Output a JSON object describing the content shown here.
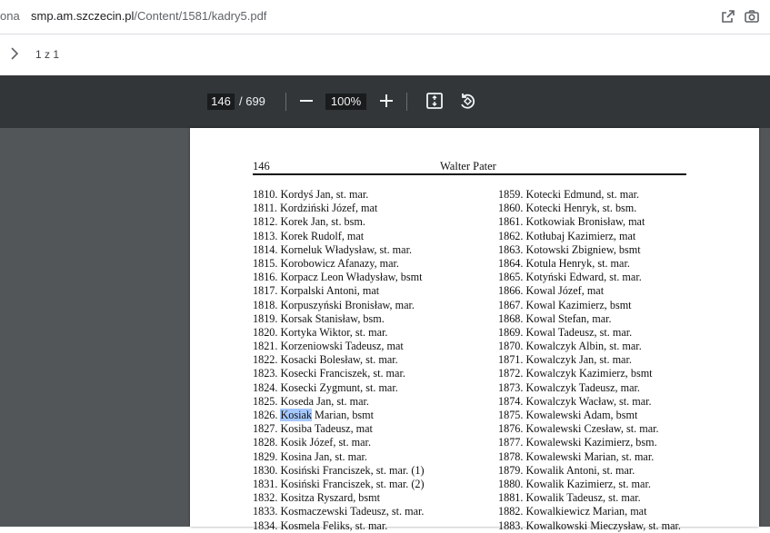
{
  "browser": {
    "left_fragment": "ona",
    "url_host": "smp.am.szczecin.pl",
    "url_path": "/Content/1581/kadry5.pdf",
    "icons": [
      "share-icon",
      "camera-icon"
    ]
  },
  "subbar": {
    "page_count": "1 z 1",
    "icon": "chevron-right-icon"
  },
  "pdf_toolbar": {
    "current_page": "146",
    "total_pages": "/ 699",
    "zoom": "100%",
    "icons": [
      "minus-icon",
      "plus-icon",
      "fit-page-icon",
      "rotate-icon"
    ]
  },
  "pdf_page": {
    "page_number": "146",
    "running_title": "Walter Pater",
    "left_column": [
      {
        "num": "1810.",
        "text": "Kordyś Jan, st. mar."
      },
      {
        "num": "1811.",
        "text": "Kordziński Józef, mat"
      },
      {
        "num": "1812.",
        "text": "Korek Jan, st. bsm."
      },
      {
        "num": "1813.",
        "text": "Korek Rudolf, mat"
      },
      {
        "num": "1814.",
        "text": "Korneluk Władysław, st. mar."
      },
      {
        "num": "1815.",
        "text": "Korobowicz Afanazy, mar."
      },
      {
        "num": "1816.",
        "text": "Korpacz Leon Władysław, bsmt"
      },
      {
        "num": "1817.",
        "text": "Korpalski Antoni, mat"
      },
      {
        "num": "1818.",
        "text": "Korpuszyński Bronisław, mar."
      },
      {
        "num": "1819.",
        "text": "Korsak Stanisław, bsm."
      },
      {
        "num": "1820.",
        "text": "Kortyka Wiktor, st. mar."
      },
      {
        "num": "1821.",
        "text": "Korzeniowski Tadeusz, mat"
      },
      {
        "num": "1822.",
        "text": "Kosacki Bolesław, st. mar."
      },
      {
        "num": "1823.",
        "text": "Kosecki Franciszek, st. mar."
      },
      {
        "num": "1824.",
        "text": "Kosecki Zygmunt, st. mar."
      },
      {
        "num": "1825.",
        "text": "Koseda Jan, st. mar."
      },
      {
        "num": "1826.",
        "text": "Marian, bsmt",
        "highlight": "Kosiak"
      },
      {
        "num": "1827.",
        "text": "Kosiba Tadeusz, mat"
      },
      {
        "num": "1828.",
        "text": "Kosik Józef, st. mar."
      },
      {
        "num": "1829.",
        "text": "Kosina Jan, st. mar."
      },
      {
        "num": "1830.",
        "text": "Kosiński Franciszek, st. mar. (1)"
      },
      {
        "num": "1831.",
        "text": "Kosiński Franciszek, st. mar. (2)"
      },
      {
        "num": "1832.",
        "text": "Kositza Ryszard, bsmt"
      },
      {
        "num": "1833.",
        "text": "Kosmaczewski Tadeusz, st. mar."
      },
      {
        "num": "1834.",
        "text": "Kosmela Feliks, st. mar."
      }
    ],
    "right_column": [
      {
        "num": "1859.",
        "text": "Kotecki Edmund, st. mar."
      },
      {
        "num": "1860.",
        "text": "Kotecki Henryk, st. bsm."
      },
      {
        "num": "1861.",
        "text": "Kotkowiak Bronisław, mat"
      },
      {
        "num": "1862.",
        "text": "Kotłubaj Kazimierz, mat"
      },
      {
        "num": "1863.",
        "text": "Kotowski Zbigniew, bsmt"
      },
      {
        "num": "1864.",
        "text": "Kotula Henryk, st. mar."
      },
      {
        "num": "1865.",
        "text": "Kotyński Edward, st. mar."
      },
      {
        "num": "1866.",
        "text": "Kowal Józef, mat"
      },
      {
        "num": "1867.",
        "text": "Kowal Kazimierz, bsmt"
      },
      {
        "num": "1868.",
        "text": "Kowal Stefan, mar."
      },
      {
        "num": "1869.",
        "text": "Kowal Tadeusz, st. mar."
      },
      {
        "num": "1870.",
        "text": "Kowalczyk Albin, st. mar."
      },
      {
        "num": "1871.",
        "text": "Kowalczyk Jan, st. mar."
      },
      {
        "num": "1872.",
        "text": "Kowalczyk Kazimierz, bsmt"
      },
      {
        "num": "1873.",
        "text": "Kowalczyk Tadeusz, mar."
      },
      {
        "num": "1874.",
        "text": "Kowalczyk Wacław, st. mar."
      },
      {
        "num": "1875.",
        "text": "Kowalewski Adam, bsmt"
      },
      {
        "num": "1876.",
        "text": "Kowalewski Czesław, st. mar."
      },
      {
        "num": "1877.",
        "text": "Kowalewski Kazimierz, bsm."
      },
      {
        "num": "1878.",
        "text": "Kowalewski Marian, st. mar."
      },
      {
        "num": "1879.",
        "text": "Kowalik Antoni, st. mar."
      },
      {
        "num": "1880.",
        "text": "Kowalik Kazimierz, st. mar."
      },
      {
        "num": "1881.",
        "text": "Kowalik Tadeusz, st. mar."
      },
      {
        "num": "1882.",
        "text": "Kowalkiewicz Marian, mat"
      },
      {
        "num": "1883.",
        "text": "Kowalkowski Mieczysław, st. mar."
      }
    ]
  }
}
